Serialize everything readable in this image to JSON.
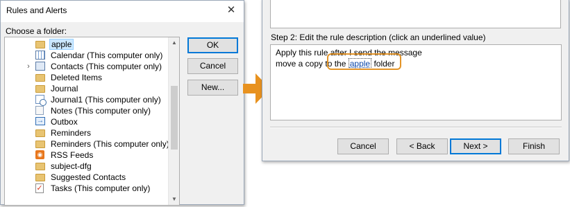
{
  "rules_dialog": {
    "title": "Rules and Alerts",
    "choose_label": "Choose a folder:",
    "folders": [
      {
        "label": "apple",
        "icon": "folder-icon",
        "selected": true,
        "expandable": false
      },
      {
        "label": "Calendar (This computer only)",
        "icon": "calendar-icon",
        "selected": false,
        "expandable": false
      },
      {
        "label": "Contacts (This computer only)",
        "icon": "contacts-icon",
        "selected": false,
        "expandable": true
      },
      {
        "label": "Deleted Items",
        "icon": "folder-icon",
        "selected": false,
        "expandable": false
      },
      {
        "label": "Journal",
        "icon": "folder-icon",
        "selected": false,
        "expandable": false
      },
      {
        "label": "Journal1 (This computer only)",
        "icon": "journal-icon",
        "selected": false,
        "expandable": false
      },
      {
        "label": "Notes (This computer only)",
        "icon": "notes-icon",
        "selected": false,
        "expandable": false
      },
      {
        "label": "Outbox",
        "icon": "outbox-icon",
        "selected": false,
        "expandable": false
      },
      {
        "label": "Reminders",
        "icon": "folder-icon",
        "selected": false,
        "expandable": false
      },
      {
        "label": "Reminders (This computer only)",
        "icon": "folder-icon",
        "selected": false,
        "expandable": false
      },
      {
        "label": "RSS Feeds",
        "icon": "rss-icon",
        "selected": false,
        "expandable": false
      },
      {
        "label": "subject-dfg",
        "icon": "folder-icon",
        "selected": false,
        "expandable": false
      },
      {
        "label": "Suggested Contacts",
        "icon": "folder-icon",
        "selected": false,
        "expandable": false
      },
      {
        "label": "Tasks (This computer only)",
        "icon": "tasks-icon",
        "selected": false,
        "expandable": false
      }
    ],
    "buttons": {
      "ok": "OK",
      "cancel": "Cancel",
      "new": "New..."
    }
  },
  "rule_wizard": {
    "step_label": "Step 2: Edit the rule description (click an underlined value)",
    "line1": "Apply this rule after I send the message",
    "line2_prefix": "move a copy to the",
    "line2_value": "apple",
    "line2_suffix": "folder",
    "buttons": {
      "cancel": "Cancel",
      "back": "< Back",
      "next": "Next >",
      "finish": "Finish"
    }
  },
  "colors": {
    "accent_orange": "#e39428",
    "selection": "#cce8ff",
    "link": "#0a46a8"
  }
}
